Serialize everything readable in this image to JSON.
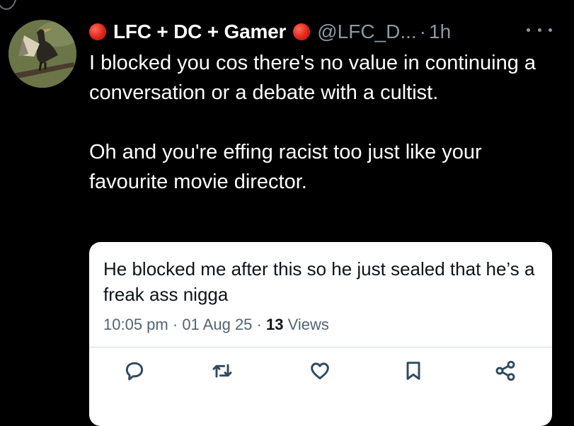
{
  "tweet": {
    "display_name": "LFC + DC + Gamer",
    "handle": "@LFC_D...",
    "separator": "·",
    "time": "1h",
    "avatar": "avatar-image",
    "more_icon": "more-horizontal-icon",
    "body": [
      "I blocked you cos there's no value in continuing a conversation or a debate with a cultist.",
      "Oh and you're effing racist too just like your favourite movie director."
    ]
  },
  "quoted_tweet": {
    "text": "He blocked me after this so he just sealed that he’s a freak ass nigga",
    "time": "10:05 pm",
    "date": "01 Aug 25",
    "dot": "·",
    "views_count": "13",
    "views_label": "Views",
    "actions": [
      "reply-icon",
      "retweet-icon",
      "like-icon",
      "bookmark-icon",
      "share-icon"
    ]
  },
  "colors": {
    "background": "#000000",
    "text": "#ffffff",
    "muted": "#8b98a5",
    "card": "#ffffff",
    "card_text": "#0f1419",
    "card_muted": "#536471",
    "red_circle": "#e0241a"
  }
}
